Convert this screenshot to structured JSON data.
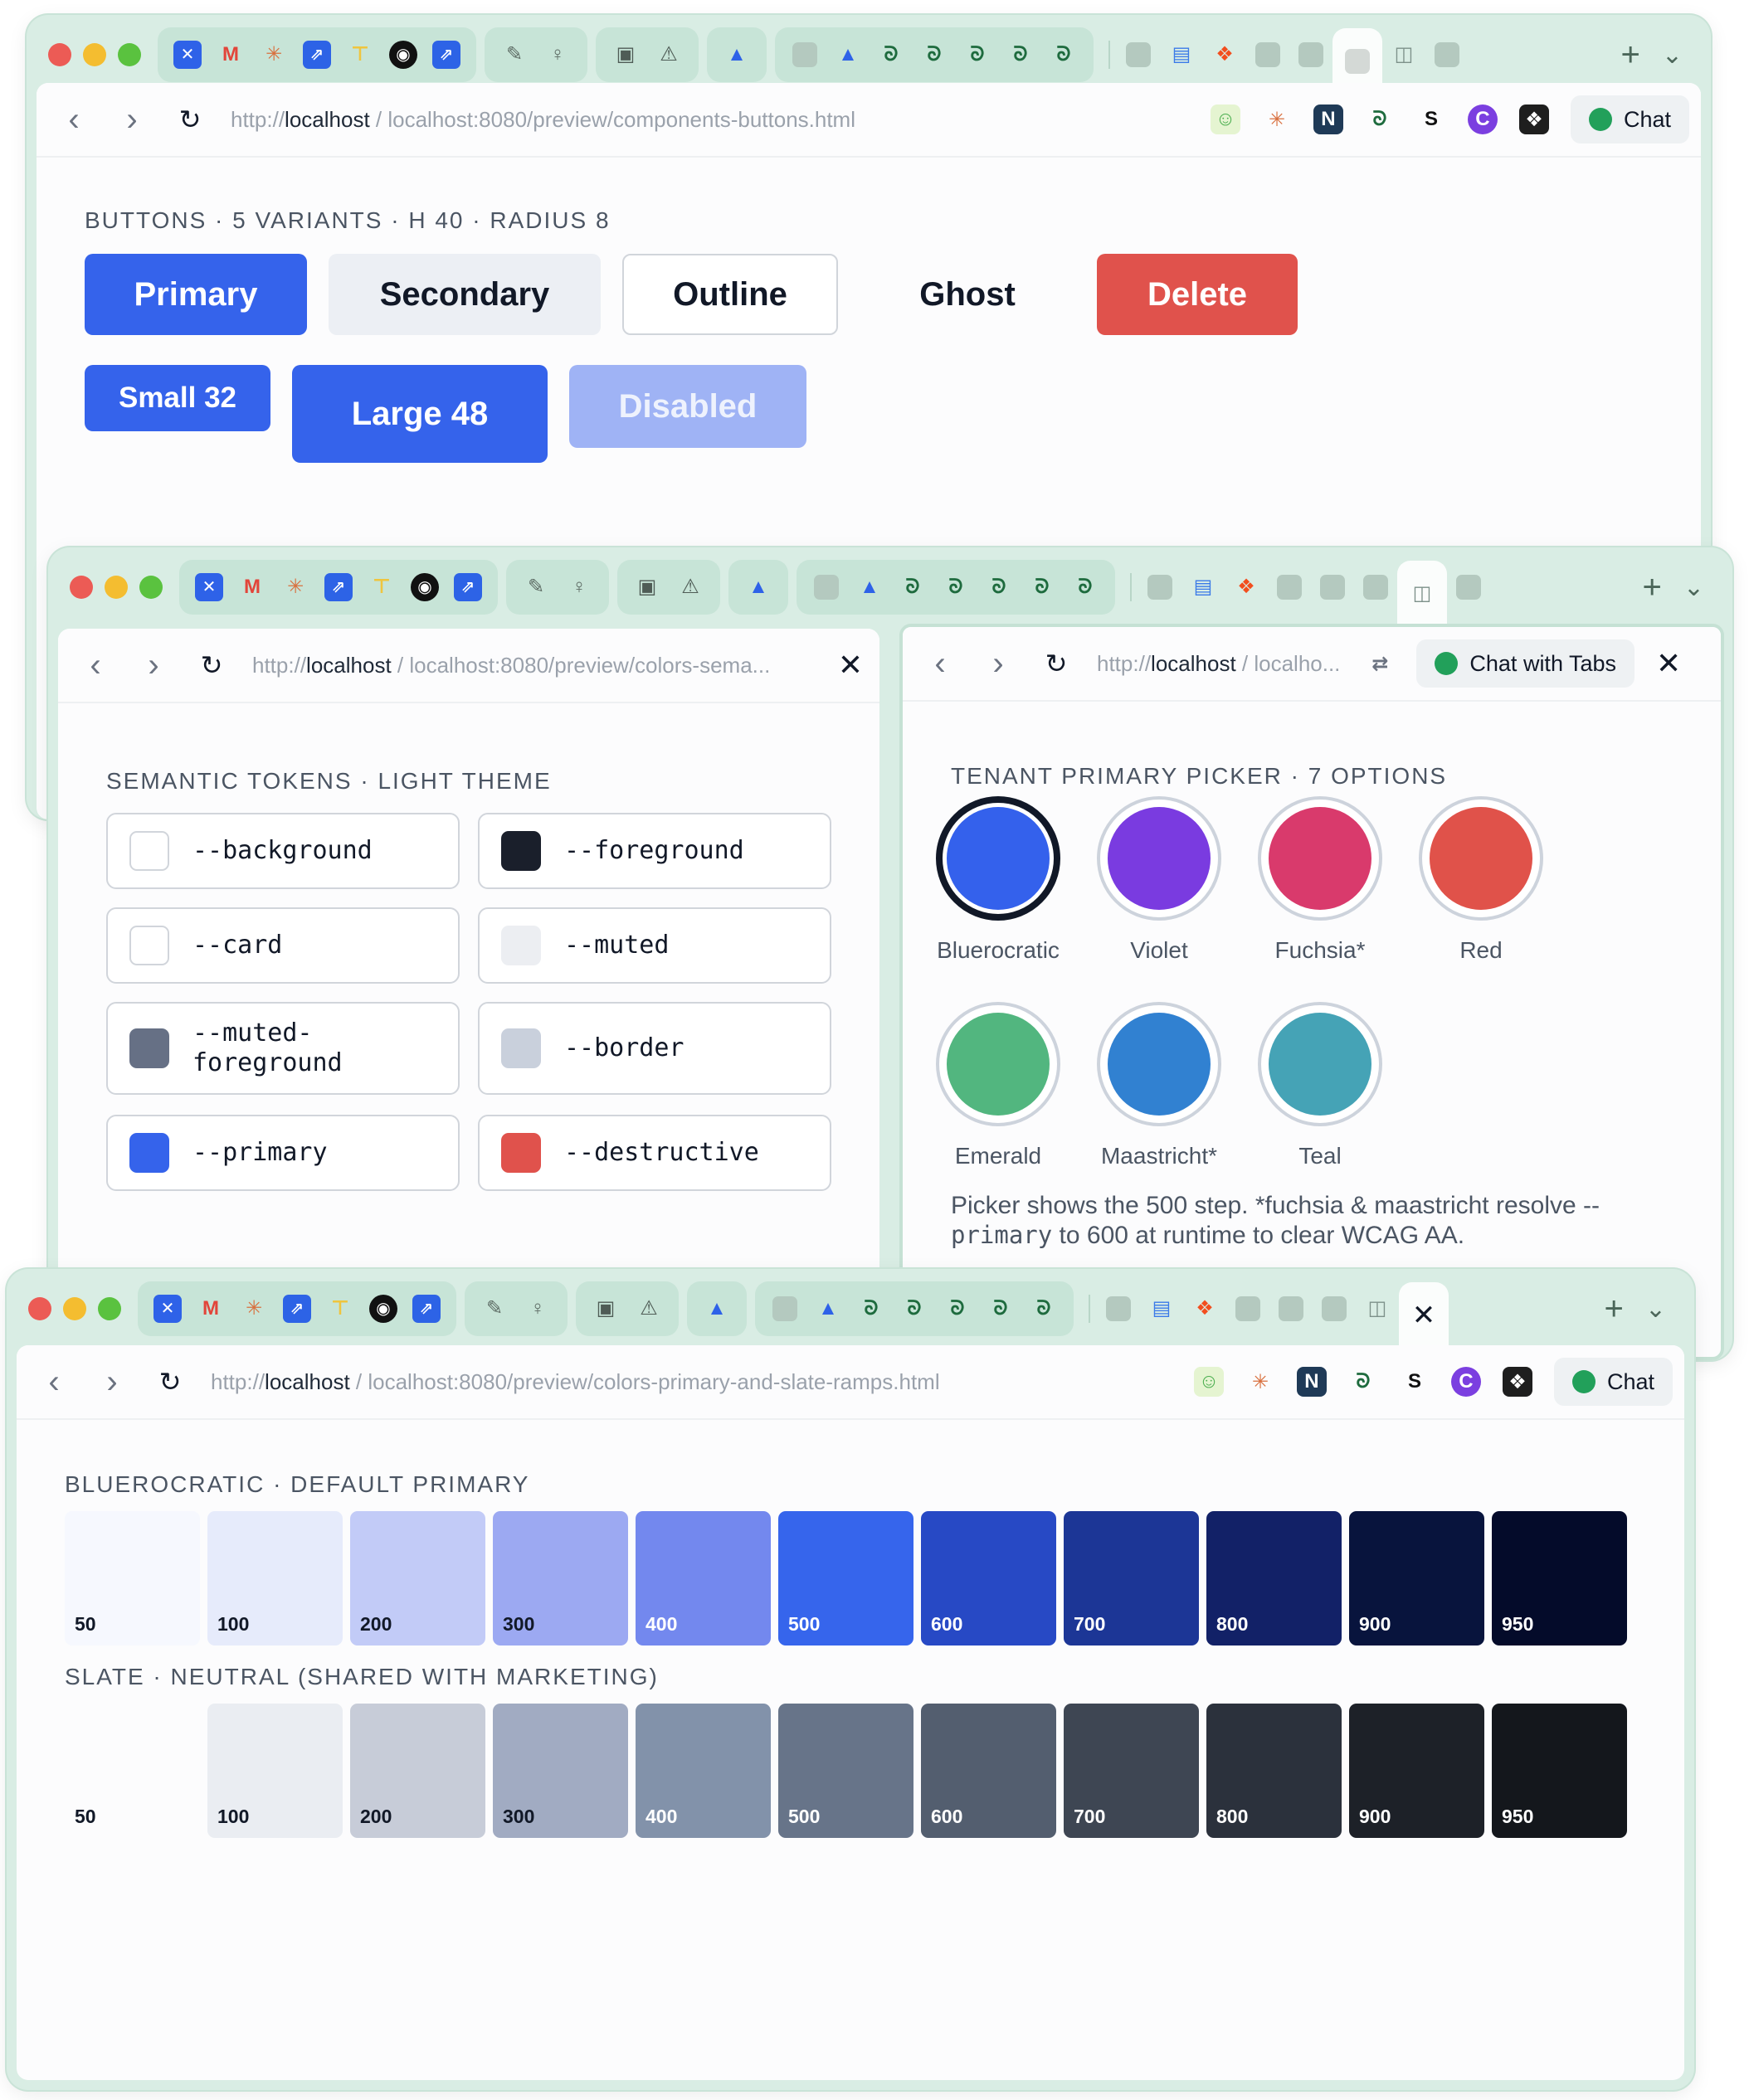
{
  "browser": {
    "chat_label": "Chat",
    "chat_tabs_label": "Chat with Tabs",
    "url_scheme": "http://",
    "url_host": "localhost"
  },
  "window1": {
    "url_rest": " / localhost:8080/preview/components-buttons.html",
    "caption": "BUTTONS · 5 VARIANTS · H 40 · RADIUS 8",
    "buttons": {
      "primary": "Primary",
      "secondary": "Secondary",
      "outline": "Outline",
      "ghost": "Ghost",
      "delete": "Delete",
      "small": "Small 32",
      "large": "Large 48",
      "disabled": "Disabled"
    }
  },
  "window2": {
    "left_url_rest": " / localhost:8080/preview/colors-sema...",
    "right_url_rest": " / localho...",
    "tokens_caption": "SEMANTIC TOKENS · LIGHT THEME",
    "tokens": [
      {
        "label": "--background",
        "color": "#ffffff"
      },
      {
        "label": "--foreground",
        "color": "#1a1f2b"
      },
      {
        "label": "--card",
        "color": "#ffffff"
      },
      {
        "label": "--muted",
        "color": "#eceef2"
      },
      {
        "label": "--muted-\nforeground",
        "color": "#667085"
      },
      {
        "label": "--border",
        "color": "#c9d0dc"
      },
      {
        "label": "--primary",
        "color": "#3563eb"
      },
      {
        "label": "--destructive",
        "color": "#e0524c"
      }
    ],
    "picker_caption": "TENANT PRIMARY PICKER · 7 OPTIONS",
    "picker": [
      {
        "label": "Bluerocratic",
        "color": "#3461ec",
        "selected": true
      },
      {
        "label": "Violet",
        "color": "#7a3be0",
        "selected": false
      },
      {
        "label": "Fuchsia*",
        "color": "#d93a6c",
        "selected": false
      },
      {
        "label": "Red",
        "color": "#e0524a",
        "selected": false
      },
      {
        "label": "Emerald",
        "color": "#52b67f",
        "selected": false
      },
      {
        "label": "Maastricht*",
        "color": "#3181d1",
        "selected": false
      },
      {
        "label": "Teal",
        "color": "#45a3b6",
        "selected": false
      }
    ],
    "note_line1": "Picker shows the 500 step. *fuchsia & maastricht resolve --",
    "note_code": "primary",
    "note_line2": " to 600 at runtime to clear WCAG AA."
  },
  "window3": {
    "url_rest": " / localhost:8080/preview/colors-primary-and-slate-ramps.html",
    "primary_caption": "BLUEROCRATIC · DEFAULT PRIMARY",
    "primary_ramp": [
      {
        "step": "50",
        "color": "#f6f8fe"
      },
      {
        "step": "100",
        "color": "#e6ebfb"
      },
      {
        "step": "200",
        "color": "#c2cbf7"
      },
      {
        "step": "300",
        "color": "#9ca9f2"
      },
      {
        "step": "400",
        "color": "#7388ee"
      },
      {
        "step": "500",
        "color": "#3665ec"
      },
      {
        "step": "600",
        "color": "#2749c5"
      },
      {
        "step": "700",
        "color": "#1c3696"
      },
      {
        "step": "800",
        "color": "#122167"
      },
      {
        "step": "900",
        "color": "#08143d"
      },
      {
        "step": "950",
        "color": "#040b2a"
      }
    ],
    "slate_caption": "SLATE · NEUTRAL (SHARED WITH MARKETING)",
    "slate_ramp": [
      {
        "step": "50",
        "color": "#fcfcfd"
      },
      {
        "step": "100",
        "color": "#eaedf2"
      },
      {
        "step": "200",
        "color": "#c7ccd8"
      },
      {
        "step": "300",
        "color": "#a1abc2"
      },
      {
        "step": "400",
        "color": "#8292aa"
      },
      {
        "step": "500",
        "color": "#677489"
      },
      {
        "step": "600",
        "color": "#535e6f"
      },
      {
        "step": "700",
        "color": "#3e4653"
      },
      {
        "step": "800",
        "color": "#2b313c"
      },
      {
        "step": "900",
        "color": "#1d2128"
      },
      {
        "step": "950",
        "color": "#14171c"
      }
    ]
  }
}
